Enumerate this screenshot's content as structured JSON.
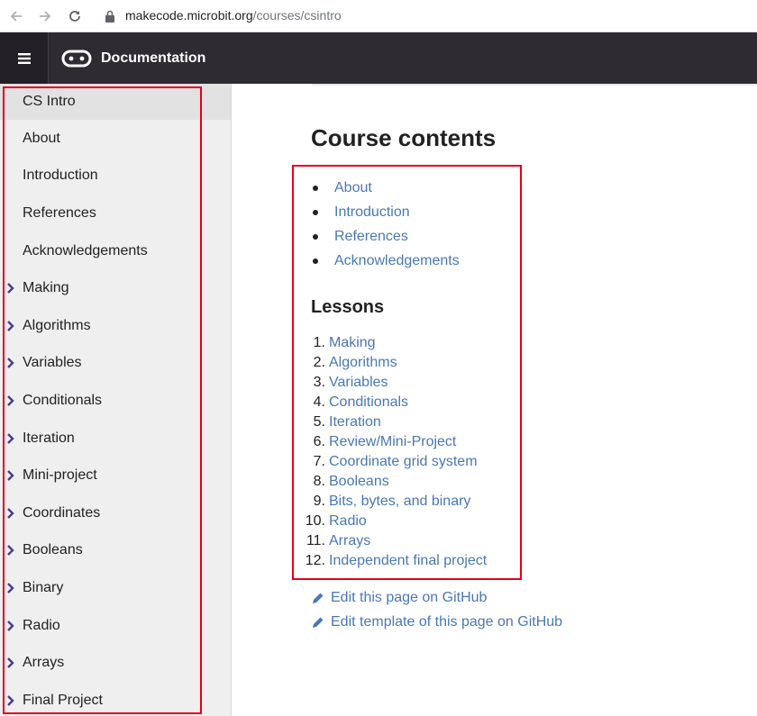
{
  "browser": {
    "url_host": "makecode.microbit.org",
    "url_path": "/courses/csintro"
  },
  "header": {
    "title": "Documentation"
  },
  "sidebar": {
    "items": [
      {
        "label": "CS Intro",
        "expandable": false,
        "active": true
      },
      {
        "label": "About",
        "expandable": false
      },
      {
        "label": "Introduction",
        "expandable": false
      },
      {
        "label": "References",
        "expandable": false
      },
      {
        "label": "Acknowledgements",
        "expandable": false
      },
      {
        "label": "Making",
        "expandable": true
      },
      {
        "label": "Algorithms",
        "expandable": true
      },
      {
        "label": "Variables",
        "expandable": true
      },
      {
        "label": "Conditionals",
        "expandable": true
      },
      {
        "label": "Iteration",
        "expandable": true
      },
      {
        "label": "Mini-project",
        "expandable": true
      },
      {
        "label": "Coordinates",
        "expandable": true
      },
      {
        "label": "Booleans",
        "expandable": true
      },
      {
        "label": "Binary",
        "expandable": true
      },
      {
        "label": "Radio",
        "expandable": true
      },
      {
        "label": "Arrays",
        "expandable": true
      },
      {
        "label": "Final Project",
        "expandable": true
      }
    ]
  },
  "main": {
    "title": "Course contents",
    "contents": [
      "About",
      "Introduction",
      "References",
      "Acknowledgements"
    ],
    "lessons_heading": "Lessons",
    "lessons": [
      {
        "num": "1.",
        "label": "Making"
      },
      {
        "num": "2.",
        "label": "Algorithms"
      },
      {
        "num": "3.",
        "label": "Variables"
      },
      {
        "num": "4.",
        "label": "Conditionals"
      },
      {
        "num": "5.",
        "label": "Iteration"
      },
      {
        "num": "6.",
        "label": "Review/Mini-Project"
      },
      {
        "num": "7.",
        "label": "Coordinate grid system"
      },
      {
        "num": "8.",
        "label": "Booleans"
      },
      {
        "num": "9.",
        "label": "Bits, bytes, and binary"
      },
      {
        "num": "10.",
        "label": "Radio"
      },
      {
        "num": "11.",
        "label": "Arrays"
      },
      {
        "num": "12.",
        "label": "Independent final project"
      }
    ],
    "edit_page": "Edit this page on GitHub",
    "edit_template": "Edit template of this page on GitHub"
  },
  "colors": {
    "link": "#4a78b4",
    "header_bg": "#2e2b33",
    "highlight_box": "#e3001b",
    "chevron": "#4b3a8c"
  }
}
